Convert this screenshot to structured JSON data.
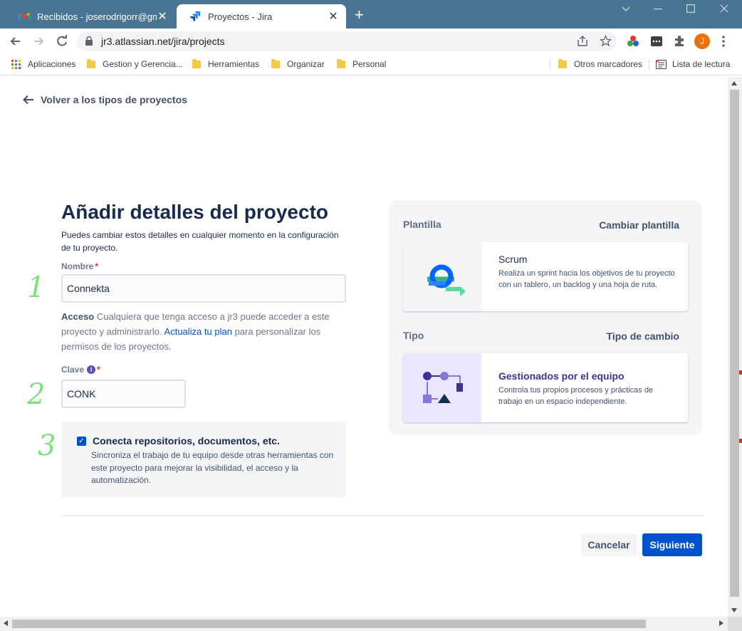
{
  "browser": {
    "tabs": [
      {
        "title": "Recibidos - joserodrigorr@gmail.",
        "icon": "gmail-icon",
        "active": false
      },
      {
        "title": "Proyectos - Jira",
        "icon": "jira-icon",
        "active": true
      }
    ],
    "close_glyph": "✕",
    "new_tab_glyph": "+",
    "url": "jr3.atlassian.net/jira/projects",
    "avatar_letter": "J",
    "bookmarks": [
      {
        "label": "Aplicaciones",
        "icon": "apps-grid-icon"
      },
      {
        "label": "Gestion y Gerencia...",
        "icon": "folder-icon"
      },
      {
        "label": "Herramientas",
        "icon": "folder-icon"
      },
      {
        "label": "Organizar",
        "icon": "folder-icon"
      },
      {
        "label": "Personal",
        "icon": "folder-icon"
      }
    ],
    "bookmarks_right": [
      {
        "label": "Otros marcadores",
        "icon": "folder-icon"
      },
      {
        "label": "Lista de lectura",
        "icon": "reading-list-icon"
      }
    ],
    "colors": {
      "tab_strip": "#4a7592",
      "avatar": "#e8710a"
    }
  },
  "page": {
    "back_link": "Volver a los tipos de proyectos",
    "title": "Añadir detalles del proyecto",
    "subtitle": "Puedes cambiar estos detalles en cualquier momento en la configuración de tu proyecto.",
    "name_field": {
      "label": "Nombre",
      "required_mark": "*",
      "value": "Connekta"
    },
    "access": {
      "label": "Acceso",
      "text_before_link": "Cualquiera que tenga acceso a jr3 puede acceder a este proyecto y administrarlo.",
      "link": "Actualiza tu plan",
      "text_after_link": "para personalizar los permisos de los proyectos."
    },
    "key_field": {
      "label": "Clave",
      "info_glyph": "i",
      "required_mark": "*",
      "value": "CONK"
    },
    "connect": {
      "checked": true,
      "check_glyph": "✓",
      "title": "Conecta repositorios, documentos, etc.",
      "description": "Sincroniza el trabajo de tu equipo desde otras herramientas con este proyecto para mejorar la visibilidad, el acceso y la automatización."
    },
    "annotations": [
      "1",
      "2",
      "3"
    ],
    "template_panel": {
      "label": "Plantilla",
      "action": "Cambiar plantilla",
      "card": {
        "title": "Scrum",
        "description": "Realiza un sprint hacia los objetivos de tu proyecto con un tablero, un backlog y una hoja de ruta."
      }
    },
    "type_panel": {
      "label": "Tipo",
      "action": "Tipo de cambio",
      "card": {
        "title": "Gestionados por el equipo",
        "description": "Controla tus propios procesos y prácticas de trabajo en un espacio independiente."
      }
    },
    "buttons": {
      "cancel": "Cancelar",
      "next": "Siguiente"
    },
    "colors": {
      "primary": "#0052cc",
      "heading": "#172b4d",
      "purple": "#5e4db2",
      "annotation": "#7de07a"
    }
  }
}
